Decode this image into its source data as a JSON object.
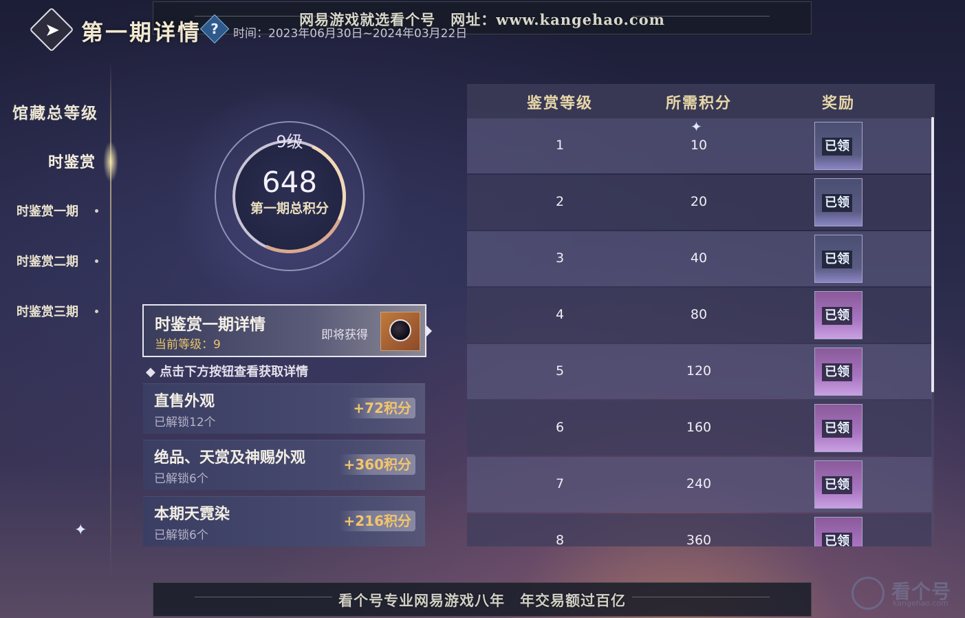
{
  "banner_top": "网易游戏就选看个号　网址：www.kangehao.com",
  "banner_bottom": "看个号专业网易游戏八年　年交易额过百亿",
  "header": {
    "title": "第一期详情",
    "help_icon": "question-icon",
    "time_label": "时间：2023年06月30日~2024年03月22日"
  },
  "nav": {
    "root": "馆藏总等级",
    "category": "时鉴赏",
    "items": [
      {
        "label": "时鉴赏一期"
      },
      {
        "label": "时鉴赏二期"
      },
      {
        "label": "时鉴赏三期"
      }
    ]
  },
  "score": {
    "level": "9级",
    "total": "648",
    "label": "第一期总积分",
    "progress_fraction": 0.4
  },
  "detail": {
    "title": "时鉴赏一期详情",
    "current_level": "当前等级：9",
    "upcoming": "即将获得"
  },
  "hint": "点击下方按钮查看获取详情",
  "categories": [
    {
      "title": "直售外观",
      "sub": "已解锁12个",
      "bonus": "+72积分"
    },
    {
      "title": "绝品、天赏及神赐外观",
      "sub": "已解锁6个",
      "bonus": "+360积分"
    },
    {
      "title": "本期天霓染",
      "sub": "已解锁6个",
      "bonus": "+216积分"
    }
  ],
  "table": {
    "headers": [
      "鉴赏等级",
      "所需积分",
      "奖励"
    ],
    "rows": [
      {
        "level": "1",
        "points": "10",
        "reward": "已领"
      },
      {
        "level": "2",
        "points": "20",
        "reward": "已领"
      },
      {
        "level": "3",
        "points": "40",
        "reward": "已领"
      },
      {
        "level": "4",
        "points": "80",
        "reward": "已领"
      },
      {
        "level": "5",
        "points": "120",
        "reward": "已领"
      },
      {
        "level": "6",
        "points": "160",
        "reward": "已领"
      },
      {
        "level": "7",
        "points": "240",
        "reward": "已领"
      },
      {
        "level": "8",
        "points": "360",
        "reward": "已领"
      }
    ]
  },
  "watermark": {
    "name": "看个号",
    "url": "kangehao.com"
  },
  "colors": {
    "gold": "#e8d7a8",
    "bonus": "#f3c56a",
    "accent_level": "#e8c56a"
  }
}
